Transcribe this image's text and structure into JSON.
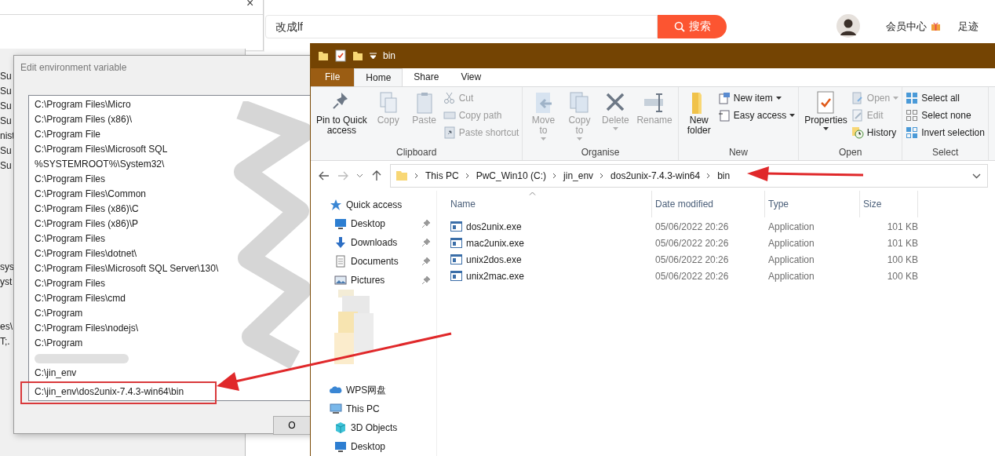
{
  "browser": {
    "search": {
      "value": "改成lf"
    },
    "search_button": "搜索",
    "links": [
      "会员中心",
      "足迹"
    ]
  },
  "background_window": {
    "close": "×",
    "fragments_top": [
      "Su",
      "Su",
      "Su",
      "Su",
      "nist",
      "Su",
      "Su"
    ],
    "fragments_bottom": [
      "sys",
      "yst"
    ],
    "fragments_lower": [
      "es\\",
      "T;."
    ]
  },
  "dialog": {
    "title": "Edit environment variable",
    "ok_button": "O",
    "entries": [
      {
        "kind": "path",
        "text": "C:\\Program Files\\Micro",
        "highlighted": false
      },
      {
        "kind": "path",
        "text": "C:\\Program Files (x86)\\",
        "highlighted": false
      },
      {
        "kind": "path",
        "text": "C:\\Program File",
        "highlighted": false
      },
      {
        "kind": "path",
        "text": "C:\\Program Files\\Microsoft SQL",
        "highlighted": false
      },
      {
        "kind": "path",
        "text": "%SYSTEMROOT%\\System32\\",
        "highlighted": false
      },
      {
        "kind": "path",
        "text": "C:\\Program Files",
        "highlighted": false
      },
      {
        "kind": "path",
        "text": "C:\\Program Files\\Common",
        "highlighted": false
      },
      {
        "kind": "path",
        "text": "C:\\Program Files (x86)\\C",
        "highlighted": false
      },
      {
        "kind": "path",
        "text": "C:\\Program Files (x86)\\P",
        "highlighted": false
      },
      {
        "kind": "path",
        "text": "C:\\Program Files",
        "highlighted": false
      },
      {
        "kind": "path",
        "text": "C:\\Program Files\\dotnet\\",
        "highlighted": false
      },
      {
        "kind": "path",
        "text": "C:\\Program Files\\Microsoft SQL Server\\130\\",
        "highlighted": false
      },
      {
        "kind": "path",
        "text": "C:\\Program Files",
        "highlighted": false
      },
      {
        "kind": "path",
        "text": "C:\\Program Files\\cmd",
        "highlighted": false
      },
      {
        "kind": "path",
        "text": "C:\\Program",
        "highlighted": false
      },
      {
        "kind": "path",
        "text": "C:\\Program Files\\nodejs\\",
        "highlighted": false
      },
      {
        "kind": "path",
        "text": "C:\\Program",
        "highlighted": false
      },
      {
        "kind": "redacted",
        "highlighted": false
      },
      {
        "kind": "path",
        "text": "C:\\jin_env",
        "highlighted": false
      },
      {
        "kind": "path",
        "text": "C:\\jin_env\\dos2unix-7.4.3-win64\\bin",
        "highlighted": true
      }
    ]
  },
  "explorer": {
    "title": "bin",
    "tabs": [
      {
        "label": "File",
        "kind": "file",
        "selected": false
      },
      {
        "label": "Home",
        "kind": "tab",
        "selected": true
      },
      {
        "label": "Share",
        "kind": "tab",
        "selected": false
      },
      {
        "label": "View",
        "kind": "tab",
        "selected": false
      }
    ],
    "ribbon": [
      {
        "label": "Clipboard",
        "items": [
          {
            "kind": "large",
            "lines": [
              "Pin to Quick",
              "access"
            ],
            "disabled": false,
            "dropdown": false
          },
          {
            "kind": "large",
            "lines": [
              "Copy"
            ],
            "disabled": true,
            "dropdown": false
          },
          {
            "kind": "large",
            "lines": [
              "Paste"
            ],
            "disabled": true,
            "dropdown": false
          },
          {
            "kind": "small",
            "label": "Cut",
            "disabled": true,
            "dropdown": false
          },
          {
            "kind": "small",
            "label": "Copy path",
            "disabled": true,
            "dropdown": false
          },
          {
            "kind": "small",
            "label": "Paste shortcut",
            "disabled": true,
            "dropdown": false
          }
        ]
      },
      {
        "label": "Organise",
        "items": [
          {
            "kind": "large",
            "lines": [
              "Move",
              "to"
            ],
            "disabled": true,
            "dropdown": true
          },
          {
            "kind": "large",
            "lines": [
              "Copy",
              "to"
            ],
            "disabled": true,
            "dropdown": true
          },
          {
            "kind": "large",
            "lines": [
              "Delete"
            ],
            "disabled": true,
            "dropdown": true
          },
          {
            "kind": "large",
            "lines": [
              "Rename"
            ],
            "disabled": true,
            "dropdown": false
          }
        ]
      },
      {
        "label": "New",
        "items": [
          {
            "kind": "large",
            "lines": [
              "New",
              "folder"
            ],
            "disabled": false,
            "dropdown": false
          },
          {
            "kind": "small",
            "label": "New item",
            "disabled": false,
            "dropdown": true
          },
          {
            "kind": "small",
            "label": "Easy access",
            "disabled": false,
            "dropdown": true
          }
        ]
      },
      {
        "label": "Open",
        "items": [
          {
            "kind": "large",
            "lines": [
              "Properties"
            ],
            "disabled": false,
            "dropdown": true
          },
          {
            "kind": "small",
            "label": "Open",
            "disabled": true,
            "dropdown": true
          },
          {
            "kind": "small",
            "label": "Edit",
            "disabled": true,
            "dropdown": false
          },
          {
            "kind": "small",
            "label": "History",
            "disabled": false,
            "dropdown": false
          }
        ]
      },
      {
        "label": "Select",
        "items": [
          {
            "kind": "small",
            "label": "Select all",
            "disabled": false,
            "dropdown": false
          },
          {
            "kind": "small",
            "label": "Select none",
            "disabled": false,
            "dropdown": false
          },
          {
            "kind": "small",
            "label": "Invert selection",
            "disabled": false,
            "dropdown": false
          }
        ]
      }
    ],
    "address": [
      "This PC",
      "PwC_Win10 (C:)",
      "jin_env",
      "dos2unix-7.4.3-win64",
      "bin"
    ],
    "nav_quick": [
      {
        "label": "Quick access",
        "kind": "section",
        "pinned": false
      },
      {
        "label": "Desktop",
        "kind": "item",
        "pinned": true
      },
      {
        "label": "Downloads",
        "kind": "item",
        "pinned": true
      },
      {
        "label": "Documents",
        "kind": "item",
        "pinned": true
      },
      {
        "label": "Pictures",
        "kind": "item",
        "pinned": true
      }
    ],
    "nav_more": [
      {
        "label": "WPS网盘",
        "kind": "section"
      },
      {
        "label": "This PC",
        "kind": "section"
      },
      {
        "label": "3D Objects",
        "kind": "item"
      },
      {
        "label": "Desktop",
        "kind": "item"
      }
    ],
    "columns": [
      "Name",
      "Date modified",
      "Type",
      "Size"
    ],
    "files": [
      {
        "name": "dos2unix.exe",
        "date": "05/06/2022 20:26",
        "type": "Application",
        "size": "101 KB"
      },
      {
        "name": "mac2unix.exe",
        "date": "05/06/2022 20:26",
        "type": "Application",
        "size": "101 KB"
      },
      {
        "name": "unix2dos.exe",
        "date": "05/06/2022 20:26",
        "type": "Application",
        "size": "100 KB"
      },
      {
        "name": "unix2mac.exe",
        "date": "05/06/2022 20:26",
        "type": "Application",
        "size": "100 KB"
      }
    ]
  }
}
